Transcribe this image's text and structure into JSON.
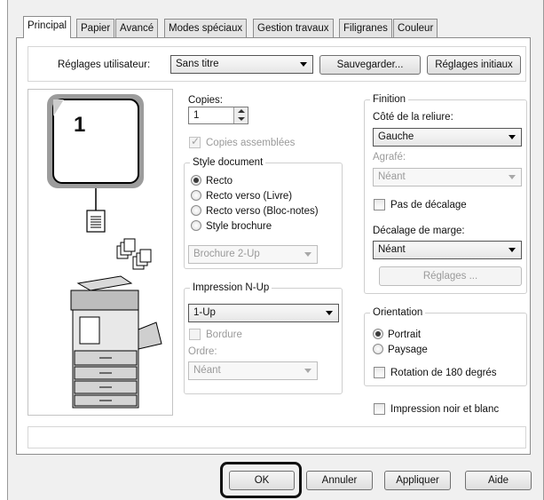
{
  "tabs": [
    {
      "label": "Principal"
    },
    {
      "label": "Papier"
    },
    {
      "label": "Avancé"
    },
    {
      "label": "Modes spéciaux"
    },
    {
      "label": "Gestion travaux"
    },
    {
      "label": "Filigranes"
    },
    {
      "label": "Couleur"
    }
  ],
  "user_settings": {
    "label": "Réglages utilisateur:",
    "value": "Sans titre",
    "save_button": "Sauvegarder...",
    "defaults_button": "Réglages initiaux"
  },
  "preview": {
    "page_number": "1",
    "icons": [
      "copier-icon",
      "collated-copies-icon",
      "document-icon"
    ]
  },
  "copies": {
    "label": "Copies:",
    "value": "1",
    "collate_label": "Copies assemblées",
    "collate_checked": true
  },
  "document_style": {
    "legend": "Style document",
    "options": [
      "Recto",
      "Recto verso (Livre)",
      "Recto verso (Bloc-notes)",
      "Style brochure"
    ],
    "selected": "Recto",
    "brochure_value": "Brochure 2-Up"
  },
  "nup": {
    "legend": "Impression N-Up",
    "value": "1-Up",
    "border_label": "Bordure",
    "order_label": "Ordre:",
    "order_value": "Néant"
  },
  "finishing": {
    "legend": "Finition",
    "binding_label": "Côté de la reliure:",
    "binding_value": "Gauche",
    "staple_label": "Agrafé:",
    "staple_value": "Néant",
    "no_offset_label": "Pas de décalage",
    "margin_shift_label": "Décalage de marge:",
    "margin_shift_value": "Néant",
    "settings_button": "Réglages ..."
  },
  "orientation": {
    "legend": "Orientation",
    "options": [
      "Portrait",
      "Paysage"
    ],
    "selected": "Portrait",
    "rotate_label": "Rotation de 180 degrés"
  },
  "bw_print_label": "Impression noir et blanc",
  "footer": {
    "ok": "OK",
    "cancel": "Annuler",
    "apply": "Appliquer",
    "help": "Aide"
  },
  "colors": {
    "highlight": "#111111",
    "panel": "#ffffff",
    "dialog": "#f0f0f0"
  }
}
